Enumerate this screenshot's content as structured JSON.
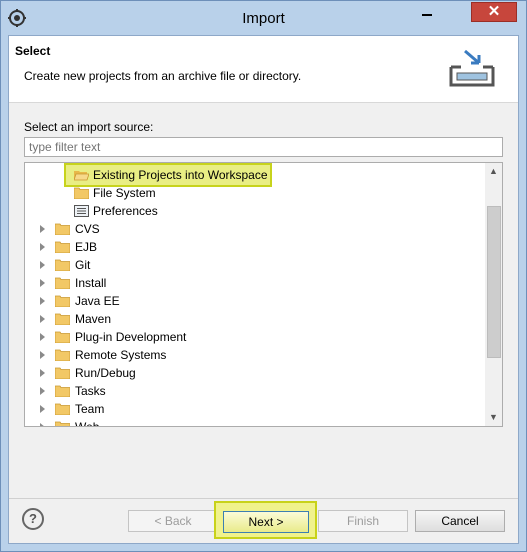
{
  "window": {
    "title": "Import",
    "close_glyph": "✕",
    "minimize_glyph": "—"
  },
  "header": {
    "title": "Select",
    "description": "Create new projects from an archive file or directory.",
    "icon": "import-icon"
  },
  "source": {
    "label": "Select an import source:",
    "filter_placeholder": "type filter text"
  },
  "tree": {
    "children": [
      {
        "label": "Existing Projects into Workspace",
        "icon": "folder-open-icon",
        "selected": true
      },
      {
        "label": "File System",
        "icon": "folder-icon"
      },
      {
        "label": "Preferences",
        "icon": "preferences-icon"
      }
    ],
    "categories": [
      {
        "label": "CVS"
      },
      {
        "label": "EJB"
      },
      {
        "label": "Git"
      },
      {
        "label": "Install"
      },
      {
        "label": "Java EE"
      },
      {
        "label": "Maven"
      },
      {
        "label": "Plug-in Development"
      },
      {
        "label": "Remote Systems"
      },
      {
        "label": "Run/Debug"
      },
      {
        "label": "Tasks"
      },
      {
        "label": "Team"
      },
      {
        "label": "Web"
      }
    ]
  },
  "buttons": {
    "help": "?",
    "back": "< Back",
    "next": "Next >",
    "finish": "Finish",
    "cancel": "Cancel"
  },
  "colors": {
    "highlight": "#e9ee84",
    "highlight_border": "#c7d31c",
    "folder": "#f2c866"
  }
}
